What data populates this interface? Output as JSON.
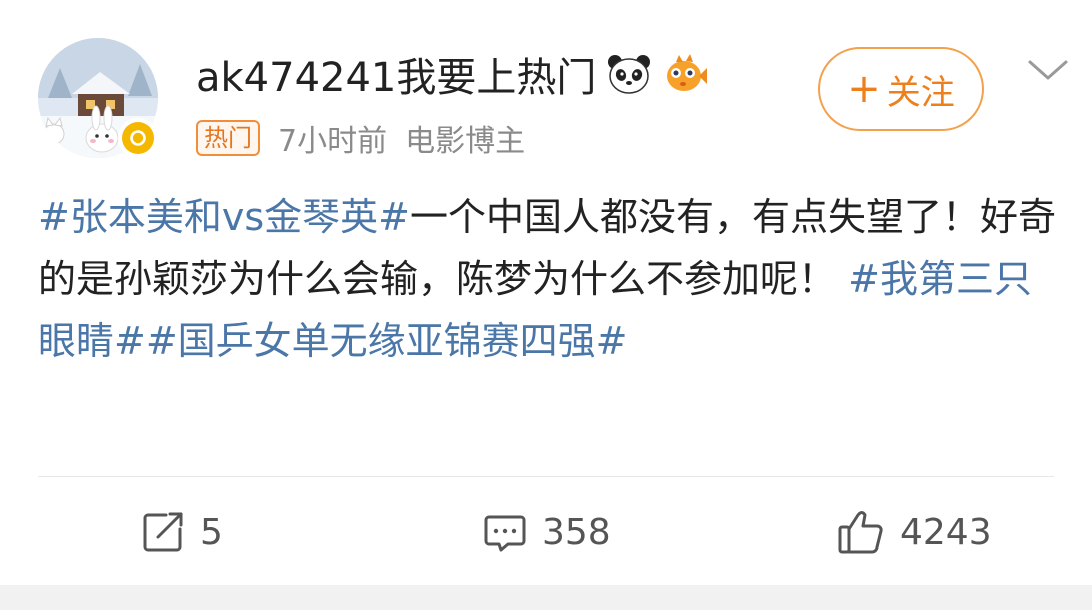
{
  "user": {
    "name": "ak474241我要上热门",
    "badge_emojis": [
      "panda-icon",
      "pufferfish-icon"
    ],
    "verified": true
  },
  "meta": {
    "hot_badge": "热门",
    "time": "7小时前",
    "role": "电影博主"
  },
  "follow": {
    "label": "关注",
    "plus": "+"
  },
  "post": {
    "segments": [
      {
        "text": "#张本美和vs金琴英#",
        "hashtag": true
      },
      {
        "text": "一个中国人都没有，有点失望了！好奇的是孙颖莎为什么会输，陈梦为什么不参加呢！",
        "hashtag": false
      },
      {
        "text": "#我第三只眼睛#",
        "hashtag": true
      },
      {
        "text": "#国乒女单无缘亚锦赛四强#",
        "hashtag": true
      }
    ]
  },
  "actions": {
    "repost_count": "5",
    "comment_count": "358",
    "like_count": "4243"
  },
  "colors": {
    "hashtag": "#4a76a8",
    "accent": "#ee7f1d",
    "hot_badge": "#e6761e",
    "meta_gray": "#8a8a8a",
    "verify": "#f5b800"
  }
}
